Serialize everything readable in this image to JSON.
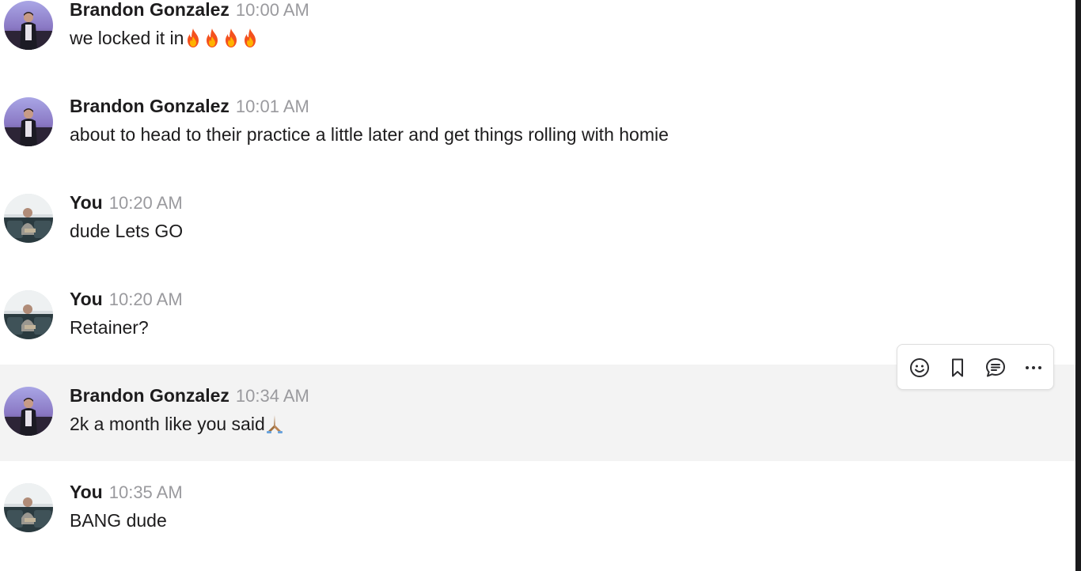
{
  "messages": [
    {
      "author": "Brandon Gonzalez",
      "time": "10:00 AM",
      "text": "we locked it in",
      "emoji": "fire x4",
      "avatar": "brandon-avatar"
    },
    {
      "author": "Brandon Gonzalez",
      "time": "10:01 AM",
      "text": "about to head to their practice a little later and get things rolling with homie",
      "avatar": "brandon-avatar"
    },
    {
      "author": "You",
      "time": "10:20 AM",
      "text": "dude Lets GO",
      "avatar": "you-avatar"
    },
    {
      "author": "You",
      "time": "10:20 AM",
      "text": "Retainer?",
      "avatar": "you-avatar"
    },
    {
      "author": "Brandon Gonzalez",
      "time": "10:34 AM",
      "text": "2k a month like you said",
      "emoji": "folded-hands (medium skin tone)",
      "avatar": "brandon-avatar",
      "hovered": true
    },
    {
      "author": "You",
      "time": "10:35 AM",
      "text": "BANG dude",
      "avatar": "you-avatar"
    }
  ],
  "hover_toolbar": {
    "actions": [
      {
        "icon": "emoji-reaction-icon"
      },
      {
        "icon": "bookmark-icon"
      },
      {
        "icon": "reply-in-thread-icon"
      },
      {
        "icon": "more-actions-icon"
      }
    ]
  },
  "colors": {
    "author_text": "#1d1c1d",
    "timestamp_text": "#9a9a9e",
    "hover_row_background": "#f3f3f3",
    "fire_emoji": "#f4511e"
  }
}
